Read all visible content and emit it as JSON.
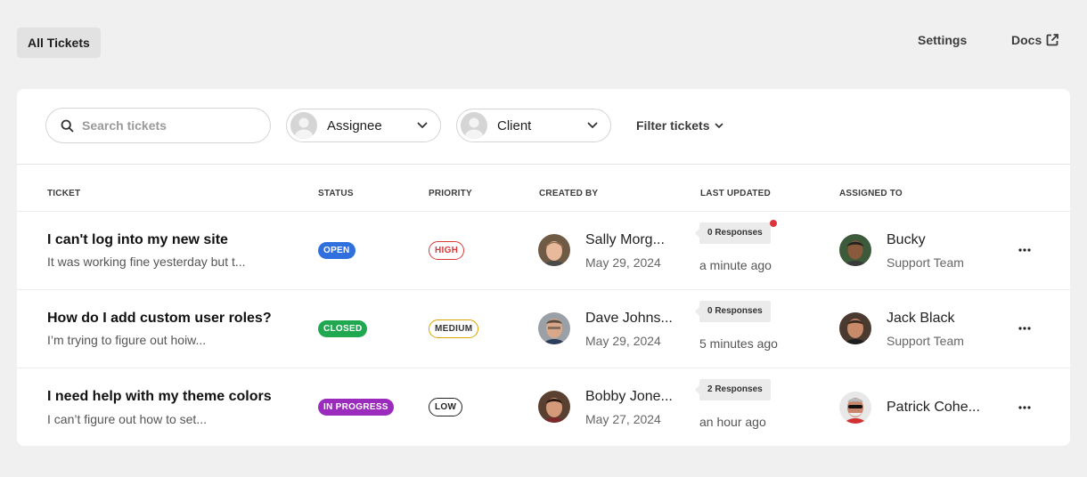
{
  "topbar": {
    "all_tickets_label": "All Tickets",
    "settings_label": "Settings",
    "docs_label": "Docs"
  },
  "filters": {
    "search_placeholder": "Search tickets",
    "assignee_label": "Assignee",
    "client_label": "Client",
    "filter_tickets_label": "Filter tickets"
  },
  "table": {
    "headers": {
      "ticket": "TICKET",
      "status": "STATUS",
      "priority": "PRIORITY",
      "created_by": "CREATED BY",
      "last_updated": "LAST UPDATED",
      "assigned_to": "ASSIGNED TO"
    },
    "rows": [
      {
        "title": "I can't log into my new site",
        "excerpt": "It was working fine yesterday but t...",
        "status": "OPEN",
        "priority": "HIGH",
        "created_by_name": "Sally Morg...",
        "created_date": "May 29, 2024",
        "responses": "0 Responses",
        "updated": "a minute ago",
        "assignee_name": "Bucky",
        "assignee_team": "Support Team"
      },
      {
        "title": "How do I add custom user roles?",
        "excerpt": "I’m trying to figure out hoiw...",
        "status": "CLOSED",
        "priority": "MEDIUM",
        "created_by_name": "Dave Johns...",
        "created_date": "May 29, 2024",
        "responses": "0 Responses",
        "updated": "5 minutes ago",
        "assignee_name": "Jack Black",
        "assignee_team": "Support Team"
      },
      {
        "title": "I need help with my theme colors",
        "excerpt": "I can’t figure out how to set...",
        "status": "IN PROGRESS",
        "priority": "LOW",
        "created_by_name": "Bobby Jone...",
        "created_date": "May 27, 2024",
        "responses": "2 Responses",
        "updated": "an hour ago",
        "assignee_name": "Patrick Cohe...",
        "assignee_team": ""
      }
    ]
  },
  "colors": {
    "status_open": "#2f6fde",
    "status_closed": "#1fa84f",
    "status_in_progress": "#9a2bbd",
    "priority_high": "#d83a3a",
    "priority_medium": "#d9a400",
    "priority_low": "#222222",
    "notification": "#e0343d"
  },
  "icons": {
    "search": "search-icon",
    "chevron": "chevron-down-icon",
    "external_link": "external-link-icon",
    "more": "more-horizontal-icon"
  }
}
